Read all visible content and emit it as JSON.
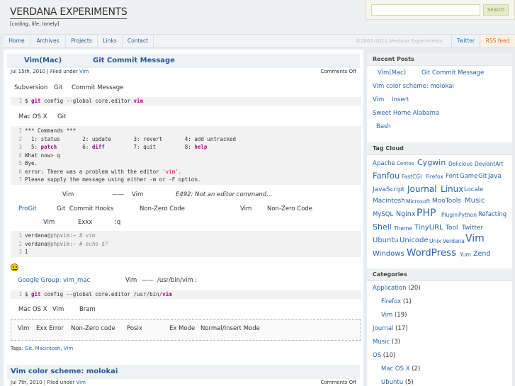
{
  "header": {
    "site_title": "VERDANA EXPERIMENTS",
    "tagline": "[coding, life, lonely]",
    "search_placeholder": "",
    "search_button": "Search"
  },
  "nav": {
    "items": [
      "Home",
      "Archives",
      "Projects",
      "Links",
      "Contact"
    ],
    "copyright": "©2007-2011 Verdana Experiments",
    "twitter": "Twitter",
    "rss": "RSS feed"
  },
  "post1": {
    "title_main": "Vim(Mac)",
    "title_sub": "Git Commit Message",
    "date": "Jul 15th, 2010 | Filed under",
    "category": "Vim",
    "comments": "Comments Off",
    "text1": [
      "Subversion",
      "Git",
      "Commit Message"
    ],
    "code1": {
      "ln": "1",
      "prompt": "$",
      "cmd": "git",
      "rest": " config --global core.editor ",
      "arg": "vim"
    },
    "text2": [
      "Mac OS X",
      "Git"
    ],
    "code2": [
      {
        "ln": "1",
        "text": "*** Commands ***"
      },
      {
        "ln": "2",
        "text": "  1: status       2: update       3: revert       4: add untracked"
      },
      {
        "ln": "3",
        "a": "  5: ",
        "k1": "patch",
        "b": "        6: ",
        "k2": "diff",
        "c": "         7: quit         8: ",
        "k3": "help"
      },
      {
        "ln": "4",
        "text": "What now> q"
      },
      {
        "ln": "5",
        "text": "Bye."
      },
      {
        "ln": "6",
        "a": "error: There was a problem with the editor ",
        "s": "'vim'",
        "b": "."
      },
      {
        "ln": "7",
        "text": "Please supply the message using either -m or -F option."
      }
    ],
    "text3": [
      "Vim",
      "——",
      "Vim",
      "E492: Not an editor command…"
    ],
    "text4": {
      "link": "ProGit",
      "t1": "Git",
      "t2": "Commit Hooks",
      "t3": "Non-Zero Code",
      "t4": "Vim",
      "t5": "Non-Zero Code"
    },
    "text5": [
      "Vim",
      "Exxx",
      ":q"
    ],
    "code3": [
      {
        "ln": "1",
        "a": "verdana",
        "b": "@phpvim:~ ",
        "c": "# vim"
      },
      {
        "ln": "2",
        "a": "verdana",
        "b": "@phpvim:~ ",
        "c": "# echo $?"
      },
      {
        "ln": "3",
        "text": "1"
      }
    ],
    "text6": {
      "link": "Google Group: vim_mac",
      "t1": "Vim",
      "t2": "——",
      "t3": "/usr/bin/vim :"
    },
    "code4": {
      "ln": "1",
      "prompt": "$",
      "cmd": "git",
      "rest": " config --global core.editor ",
      "p1": "/",
      "p2": "usr",
      "p3": "/",
      "p4": "bin",
      "p5": "/",
      "arg": "vim"
    },
    "text7": [
      "Mac OS X",
      "Vim",
      "Bram"
    ],
    "box": [
      "Vim",
      "Exx Error",
      "Non-Zero code",
      "Posix",
      "Ex Mode",
      "Normal/Insert Mode"
    ],
    "tags_label": "Tags:",
    "tags": [
      "Git",
      "Macintosh",
      "Vim"
    ]
  },
  "post2": {
    "title": "Vim color scheme: molokai",
    "date": "Jul 7th, 2010 | Filed under",
    "category": "Vim",
    "comments": "Comments Off"
  },
  "sidebar": {
    "recent_title": "Recent Posts",
    "recent": [
      {
        "a": "Vim(Mac)",
        "b": "Git Commit Message"
      },
      {
        "a": "Vim color scheme: molokai"
      },
      {
        "a": "Vim",
        "b": "Insert"
      },
      {
        "a": "Sweet Home Alabama"
      },
      {
        "a": "Bash"
      }
    ],
    "tagcloud_title": "Tag Cloud",
    "tags": [
      "Apache",
      "Centos",
      "Cygwin",
      "Delicious",
      "DeviantArt",
      "Fanfou",
      "FastCGI",
      "Firefox",
      "Font",
      "Game",
      "Git",
      "Java",
      "JavaScript",
      "Journal",
      "Linux",
      "Locale",
      "Macintosh",
      "Microsoft",
      "MooTools",
      "Music",
      "MySQL",
      "Nginx",
      "PHP",
      "Plugin",
      "Python",
      "Refacting",
      "Shell",
      "Theme",
      "TinyURL",
      "Tool",
      "Twitter",
      "Ubuntu",
      "Unicode",
      "Unix",
      "Verdana",
      "Vim",
      "Windows",
      "WordPress",
      "Yum",
      "Zend"
    ],
    "categories_title": "Categories",
    "categories": [
      {
        "name": "Application",
        "count": "(20)"
      },
      {
        "name": "Firefox",
        "count": "(1)"
      },
      {
        "name": "Vim",
        "count": "(19)"
      },
      {
        "name": "Journal",
        "count": "(17)"
      },
      {
        "name": "Music",
        "count": "(3)"
      },
      {
        "name": "OS",
        "count": "(10)"
      },
      {
        "name": "Mac OS X",
        "count": "(2)"
      },
      {
        "name": "Ubuntu",
        "count": "(5)"
      }
    ]
  }
}
